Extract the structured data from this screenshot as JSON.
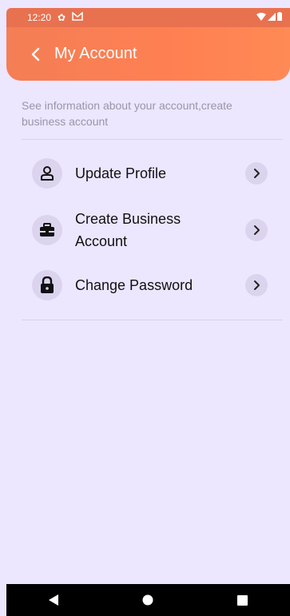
{
  "status_bar": {
    "time": "12:20"
  },
  "header": {
    "title": "My Account"
  },
  "description": "See information about your account,create business account",
  "menu": [
    {
      "label": "Update Profile",
      "icon": "person-icon"
    },
    {
      "label": "Create Business Account",
      "icon": "briefcase-icon"
    },
    {
      "label": "Change Password",
      "icon": "lock-icon"
    }
  ],
  "colors": {
    "accent": "#FF8052",
    "background": "#EDE6FF",
    "icon_bg": "#DCD4EE"
  }
}
